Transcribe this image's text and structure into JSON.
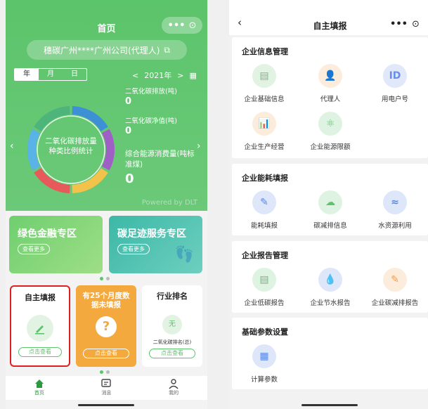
{
  "left": {
    "nav_title": "首页",
    "company": "穗碳广州****广州公司(代理人)",
    "period_tabs": [
      "年",
      "月",
      "日"
    ],
    "year": "2021年",
    "donut_label": [
      "二氧化碳排放量",
      "种类比例统计"
    ],
    "stats": [
      {
        "label": "二氧化碳排放(吨)",
        "value": "0"
      },
      {
        "label": "二氧化碳净值(吨)",
        "value": "0"
      },
      {
        "label": "综合能源消费量(吨标准煤)",
        "value": "0"
      }
    ],
    "powered": "Powered by DLT",
    "banners": [
      {
        "title": "绿色金融专区",
        "button": "查看更多"
      },
      {
        "title": "碳足迹服务专区",
        "button": "查看更多"
      }
    ],
    "cards": [
      {
        "title": "自主填报",
        "button": "点击查看"
      },
      {
        "title": "有25个月度数据未填报",
        "glyph": "?",
        "button": "点击查看"
      },
      {
        "title": "行业排名",
        "badge": "无",
        "subtitle": "二氧化碳排名(总)",
        "button": "点击查看"
      }
    ],
    "tabs": [
      "首页",
      "消息",
      "我的"
    ],
    "donut_colors": [
      "#3d8fd6",
      "#a05fc7",
      "#f2c24b",
      "#e8595b",
      "#5ab3e6",
      "#4db57a"
    ]
  },
  "right": {
    "nav_title": "自主填报",
    "sections": [
      {
        "title": "企业信息管理",
        "items": [
          {
            "label": "企业基础信息",
            "icon": "document-icon",
            "color": "#6cc47a"
          },
          {
            "label": "代理人",
            "icon": "agent-icon",
            "color": "#f0a050"
          },
          {
            "label": "用电户号",
            "icon": "id-icon",
            "color": "#6a8ee8"
          },
          {
            "label": "企业生产经营",
            "icon": "chart-icon",
            "color": "#f0a050"
          },
          {
            "label": "企业能源限额",
            "icon": "atom-icon",
            "color": "#5cc46b"
          }
        ]
      },
      {
        "title": "企业能耗填报",
        "items": [
          {
            "label": "能耗填报",
            "icon": "form-icon",
            "color": "#5a86e0"
          },
          {
            "label": "碳减排信息",
            "icon": "cloud-icon",
            "color": "#5cc46b"
          },
          {
            "label": "水资源利用",
            "icon": "water-icon",
            "color": "#5a86e0"
          }
        ]
      },
      {
        "title": "企业报告管理",
        "items": [
          {
            "label": "企业低碳报告",
            "icon": "report-icon",
            "color": "#5cc46b"
          },
          {
            "label": "企业节水报告",
            "icon": "drop-icon",
            "color": "#5a86e0"
          },
          {
            "label": "企业碳减排报告",
            "icon": "report-edit-icon",
            "color": "#f0a050"
          }
        ]
      },
      {
        "title": "基础参数设置",
        "items": [
          {
            "label": "计算参数",
            "icon": "calculator-icon",
            "color": "#5a86e0"
          }
        ]
      }
    ]
  }
}
